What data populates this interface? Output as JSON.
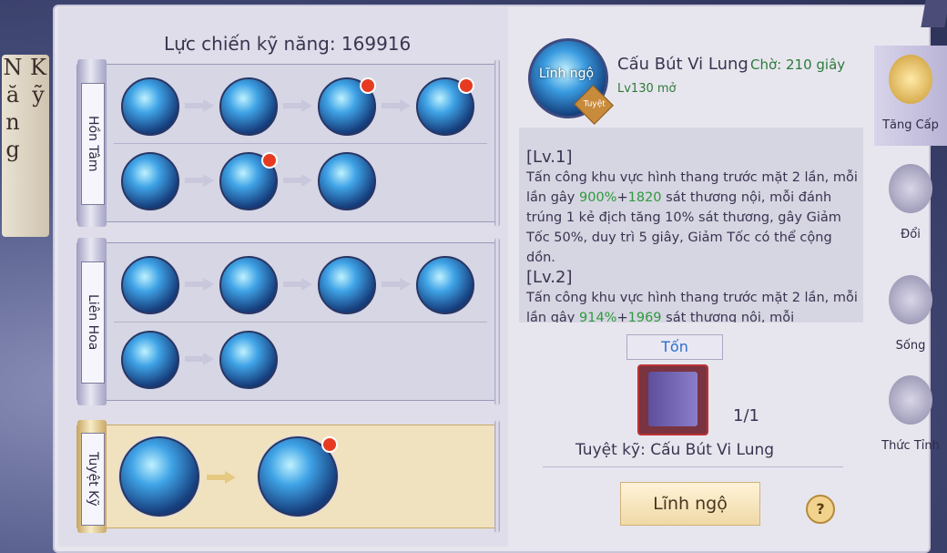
{
  "side_title": "Kỹ Năng",
  "combat_power": "Lực chiến kỹ năng: 169916",
  "schools": [
    {
      "label": "Hồn Tâm"
    },
    {
      "label": "Liên Hoa"
    },
    {
      "label": "Tuyệt Kỹ"
    }
  ],
  "detail": {
    "icon_label": "Lĩnh ngộ",
    "tag": "Tuyệt",
    "name": "Cấu Bút Vi Lung",
    "cooldown": "Chờ: 210 giây",
    "unlock": "Lv130 mở",
    "lv1_title": "[Lv.1]",
    "lv1_a": "Tấn công khu vực hình thang trước mặt 2 lần, mỗi lần gây ",
    "lv1_pct": "900%",
    "lv1_plus": "+",
    "lv1_flat": "1820",
    "lv1_b": " sát thương nội, mỗi đánh trúng 1 kẻ địch tăng 10% sát thương, gây Giảm Tốc 50%, duy trì 5 giây, Giảm Tốc có thể cộng dồn.",
    "lv2_title": "[Lv.2]",
    "lv2_a": "Tấn công khu vực hình thang trước mặt 2 lần, mỗi lần gây ",
    "lv2_pct": "914%",
    "lv2_plus": "+",
    "lv2_flat": "1969",
    "lv2_b": " sát thương nội, mỗi"
  },
  "cost": {
    "title": "Tốn",
    "count": "1/1",
    "book_name": "Tuyệt kỹ: Cấu Bút Vi Lung"
  },
  "learn_button": "Lĩnh ngộ",
  "help": "?",
  "tabs": [
    {
      "label": "Tăng Cấp"
    },
    {
      "label": "Đổi"
    },
    {
      "label": "Sống"
    },
    {
      "label": "Thức Tỉnh"
    }
  ]
}
